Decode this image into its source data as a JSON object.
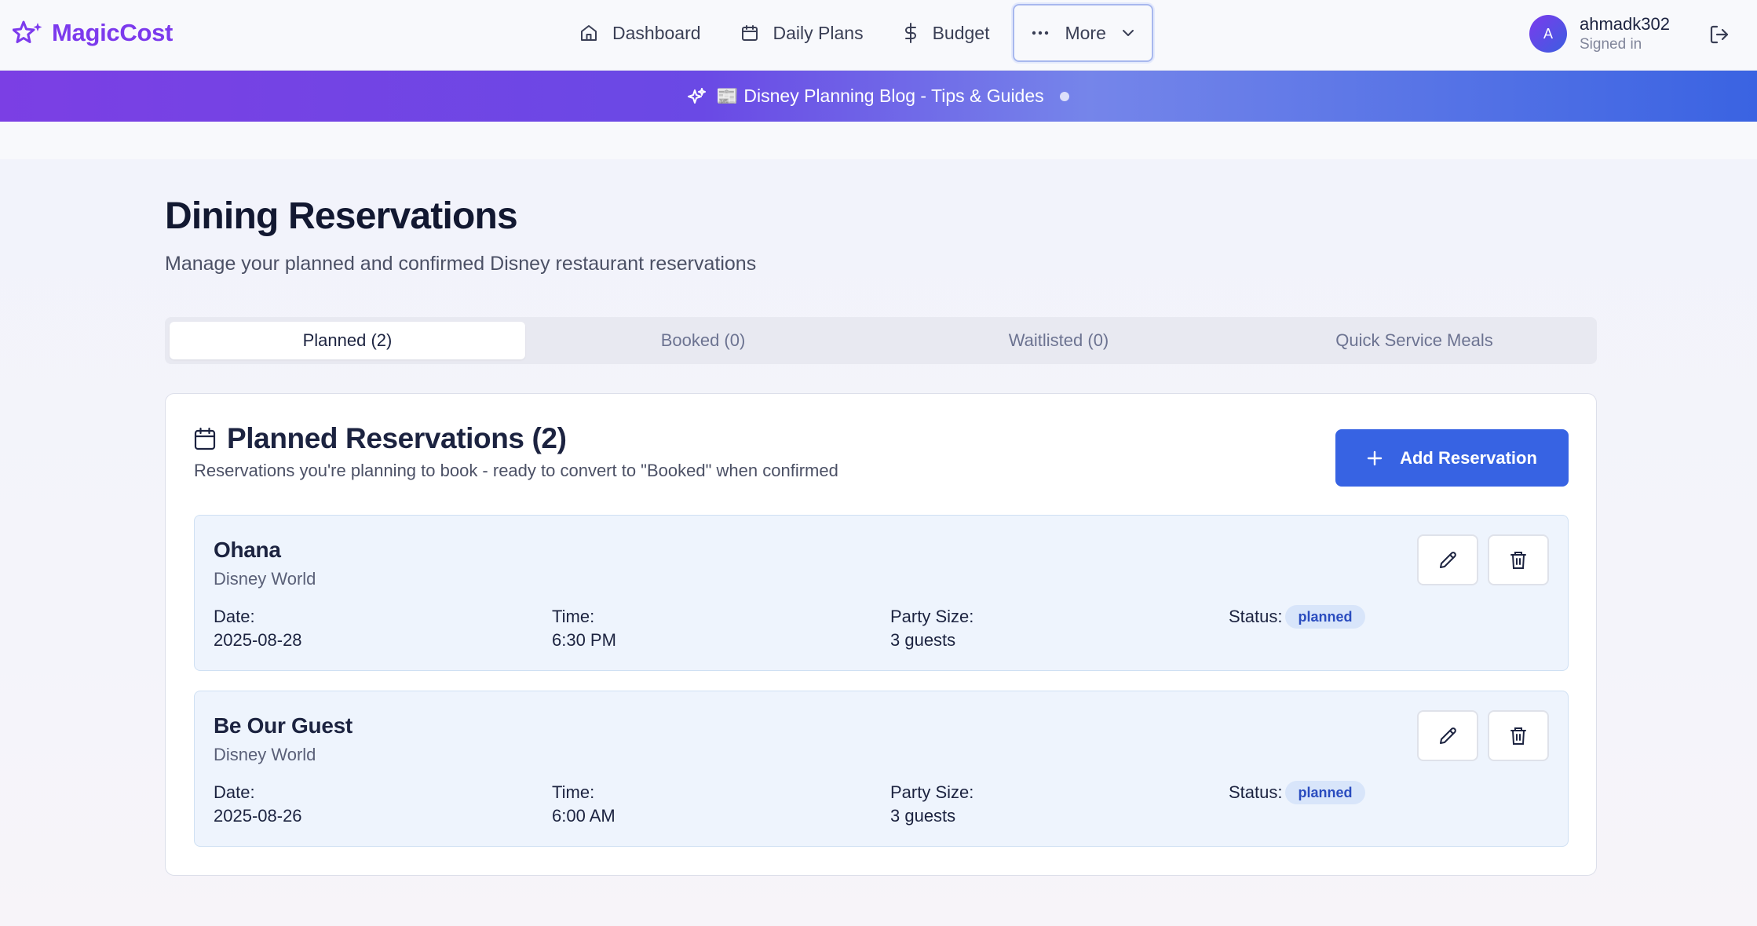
{
  "brand": {
    "name": "MagicCost",
    "color": "#7c3aed",
    "icon": "sparkles-icon"
  },
  "nav": {
    "items": [
      {
        "label": "Dashboard",
        "icon": "home-icon"
      },
      {
        "label": "Daily Plans",
        "icon": "calendar-icon"
      },
      {
        "label": "Budget",
        "icon": "dollar-icon"
      },
      {
        "label": "More",
        "icon": "ellipsis-icon"
      }
    ]
  },
  "user": {
    "avatar_initial": "A",
    "name": "ahmadk302",
    "status": "Signed in"
  },
  "banner": {
    "text": "📰 Disney Planning Blog - Tips & Guides"
  },
  "page": {
    "title": "Dining Reservations",
    "subtitle": "Manage your planned and confirmed Disney restaurant reservations"
  },
  "tabs": [
    {
      "label": "Planned (2)",
      "active": true
    },
    {
      "label": "Booked (0)",
      "active": false
    },
    {
      "label": "Waitlisted (0)",
      "active": false
    },
    {
      "label": "Quick Service Meals",
      "active": false
    }
  ],
  "card": {
    "title": "Planned Reservations (2)",
    "subtitle": "Reservations you're planning to book - ready to convert to \"Booked\" when confirmed",
    "add_button": "Add Reservation",
    "labels": {
      "date": "Date:",
      "time": "Time:",
      "party": "Party Size:",
      "status": "Status:"
    }
  },
  "reservations": [
    {
      "name": "Ohana",
      "park": "Disney World",
      "date": "2025-08-28",
      "time": "6:30 PM",
      "party": "3 guests",
      "status": "planned"
    },
    {
      "name": "Be Our Guest",
      "park": "Disney World",
      "date": "2025-08-26",
      "time": "6:00 AM",
      "party": "3 guests",
      "status": "planned"
    }
  ],
  "colors": {
    "accent": "#3763e3",
    "badge_bg": "#d8e5fa",
    "badge_text": "#2a4cbf"
  }
}
